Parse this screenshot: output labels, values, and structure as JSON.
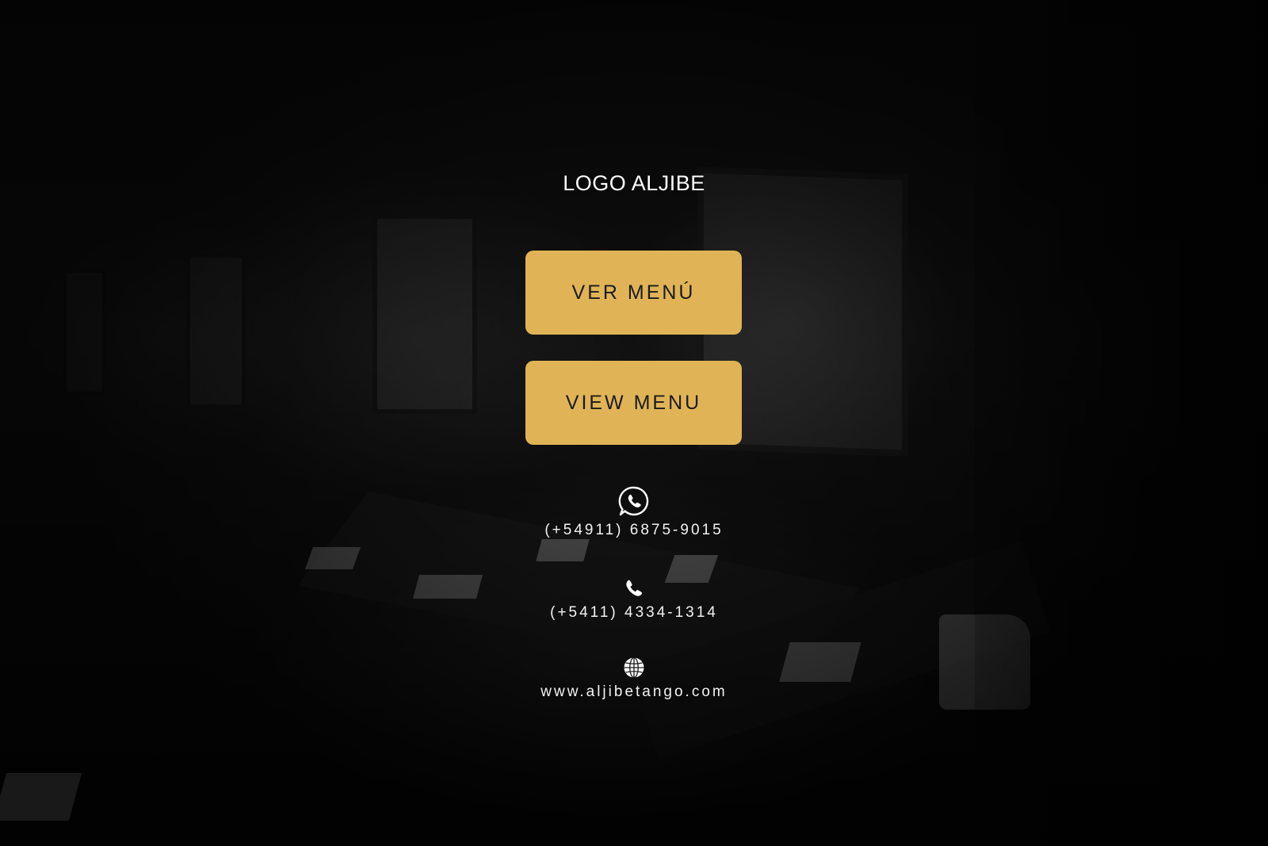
{
  "logo": {
    "text": "LOGO ALJIBE"
  },
  "buttons": {
    "ver_menu": "VER MENÚ",
    "view_menu": "VIEW MENU"
  },
  "contact": {
    "whatsapp": {
      "icon": "whatsapp-icon",
      "text": "(+54911) 6875-9015"
    },
    "phone": {
      "icon": "phone-icon",
      "text": "(+5411) 4334-1314"
    },
    "website": {
      "icon": "globe-icon",
      "text": "www.aljibetango.com"
    }
  },
  "colors": {
    "button_bg": "#e0b456",
    "button_text": "#1b1b1b",
    "text": "#ffffff"
  }
}
